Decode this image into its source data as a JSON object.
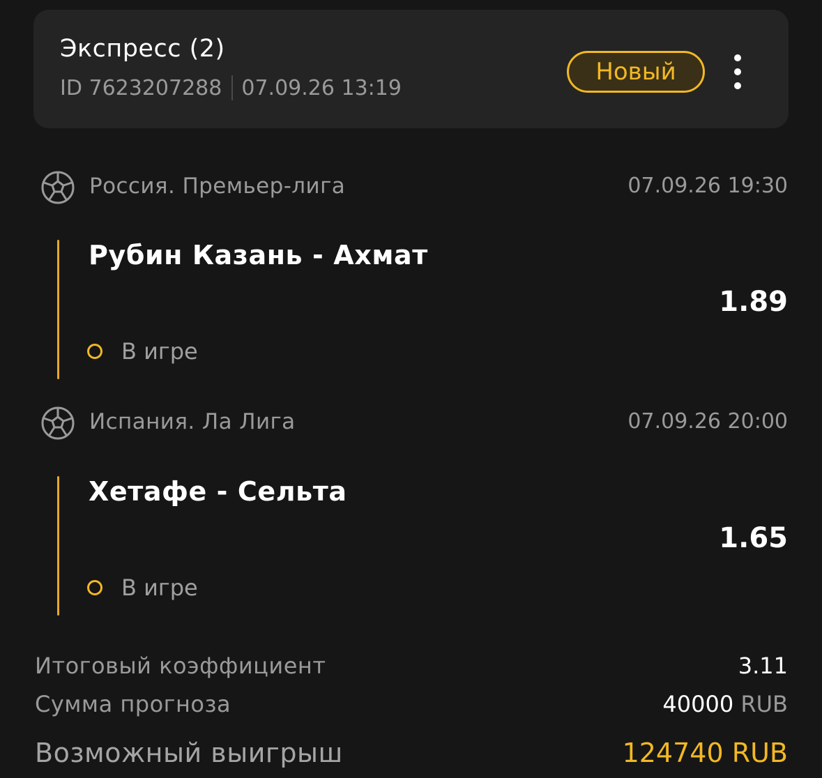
{
  "header": {
    "title": "Экспресс (2)",
    "bet_id": "ID 7623207288",
    "created": "07.09.26 13:19",
    "status_badge": "Новый"
  },
  "events": [
    {
      "league": "Россия. Премьер-лига",
      "start_time": "07.09.26 19:30",
      "match": "Рубин Казань - Ахмат",
      "odds": "1.89",
      "status": "В игре",
      "icon": "soccer-ball-icon"
    },
    {
      "league": "Испания. Ла Лига",
      "start_time": "07.09.26 20:00",
      "match": "Хетафе - Сельта",
      "odds": "1.65",
      "status": "В игре",
      "icon": "soccer-ball-icon"
    }
  ],
  "summary": {
    "total_odds_label": "Итоговый коэффициент",
    "total_odds_value": "3.11",
    "stake_label": "Сумма прогноза",
    "stake_amount": "40000",
    "stake_currency": "RUB",
    "win_label": "Возможный выигрыш",
    "win_value": "124740 RUB"
  },
  "colors": {
    "background": "#161616",
    "card": "#242424",
    "accent": "#f2b824",
    "muted_text": "#9a9a9a",
    "text": "#ffffff"
  }
}
